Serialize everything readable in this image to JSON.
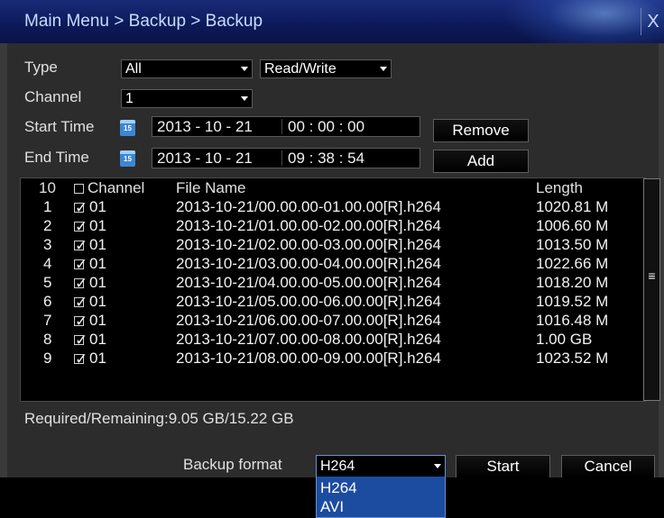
{
  "window": {
    "title": "Main Menu > Backup > Backup",
    "close_glyph": "X"
  },
  "filters": {
    "type_label": "Type",
    "type_value": "All",
    "mode_value": "Read/Write",
    "channel_label": "Channel",
    "channel_value": "1",
    "start_label": "Start Time",
    "start_date": "2013 - 10 - 21",
    "start_time": "00 : 00 : 00",
    "end_label": "End Time",
    "end_date": "2013 - 10 - 21",
    "end_time": "09 : 38 : 54",
    "calendar_glyph": "15"
  },
  "buttons": {
    "remove": "Remove",
    "add": "Add",
    "start": "Start",
    "cancel": "Cancel"
  },
  "table": {
    "header": {
      "count": "10",
      "channel": "Channel",
      "file_name": "File Name",
      "length": "Length"
    },
    "rows": [
      {
        "no": "1",
        "checked": true,
        "channel": "01",
        "file": "2013-10-21/00.00.00-01.00.00[R].h264",
        "length": "1020.81 M"
      },
      {
        "no": "2",
        "checked": true,
        "channel": "01",
        "file": "2013-10-21/01.00.00-02.00.00[R].h264",
        "length": "1006.60 M"
      },
      {
        "no": "3",
        "checked": true,
        "channel": "01",
        "file": "2013-10-21/02.00.00-03.00.00[R].h264",
        "length": "1013.50 M"
      },
      {
        "no": "4",
        "checked": true,
        "channel": "01",
        "file": "2013-10-21/03.00.00-04.00.00[R].h264",
        "length": "1022.66 M"
      },
      {
        "no": "5",
        "checked": true,
        "channel": "01",
        "file": "2013-10-21/04.00.00-05.00.00[R].h264",
        "length": "1018.20 M"
      },
      {
        "no": "6",
        "checked": true,
        "channel": "01",
        "file": "2013-10-21/05.00.00-06.00.00[R].h264",
        "length": "1019.52 M"
      },
      {
        "no": "7",
        "checked": true,
        "channel": "01",
        "file": "2013-10-21/06.00.00-07.00.00[R].h264",
        "length": "1016.48 M"
      },
      {
        "no": "8",
        "checked": true,
        "channel": "01",
        "file": "2013-10-21/07.00.00-08.00.00[R].h264",
        "length": "1.00 GB"
      },
      {
        "no": "9",
        "checked": true,
        "channel": "01",
        "file": "2013-10-21/08.00.00-09.00.00[R].h264",
        "length": "1023.52 M"
      }
    ],
    "scroll_glyph": "≡"
  },
  "status": {
    "required_remaining": "Required/Remaining:9.05 GB/15.22 GB"
  },
  "backup": {
    "format_label": "Backup format",
    "format_value": "H264",
    "options": [
      "H264",
      "AVI"
    ]
  },
  "colors": {
    "title_bar": "#0d1a5a",
    "panel_bg": "#2c2c2c",
    "dropdown_bg": "#1c4ca0",
    "calendar_icon": "#3d86d4"
  }
}
